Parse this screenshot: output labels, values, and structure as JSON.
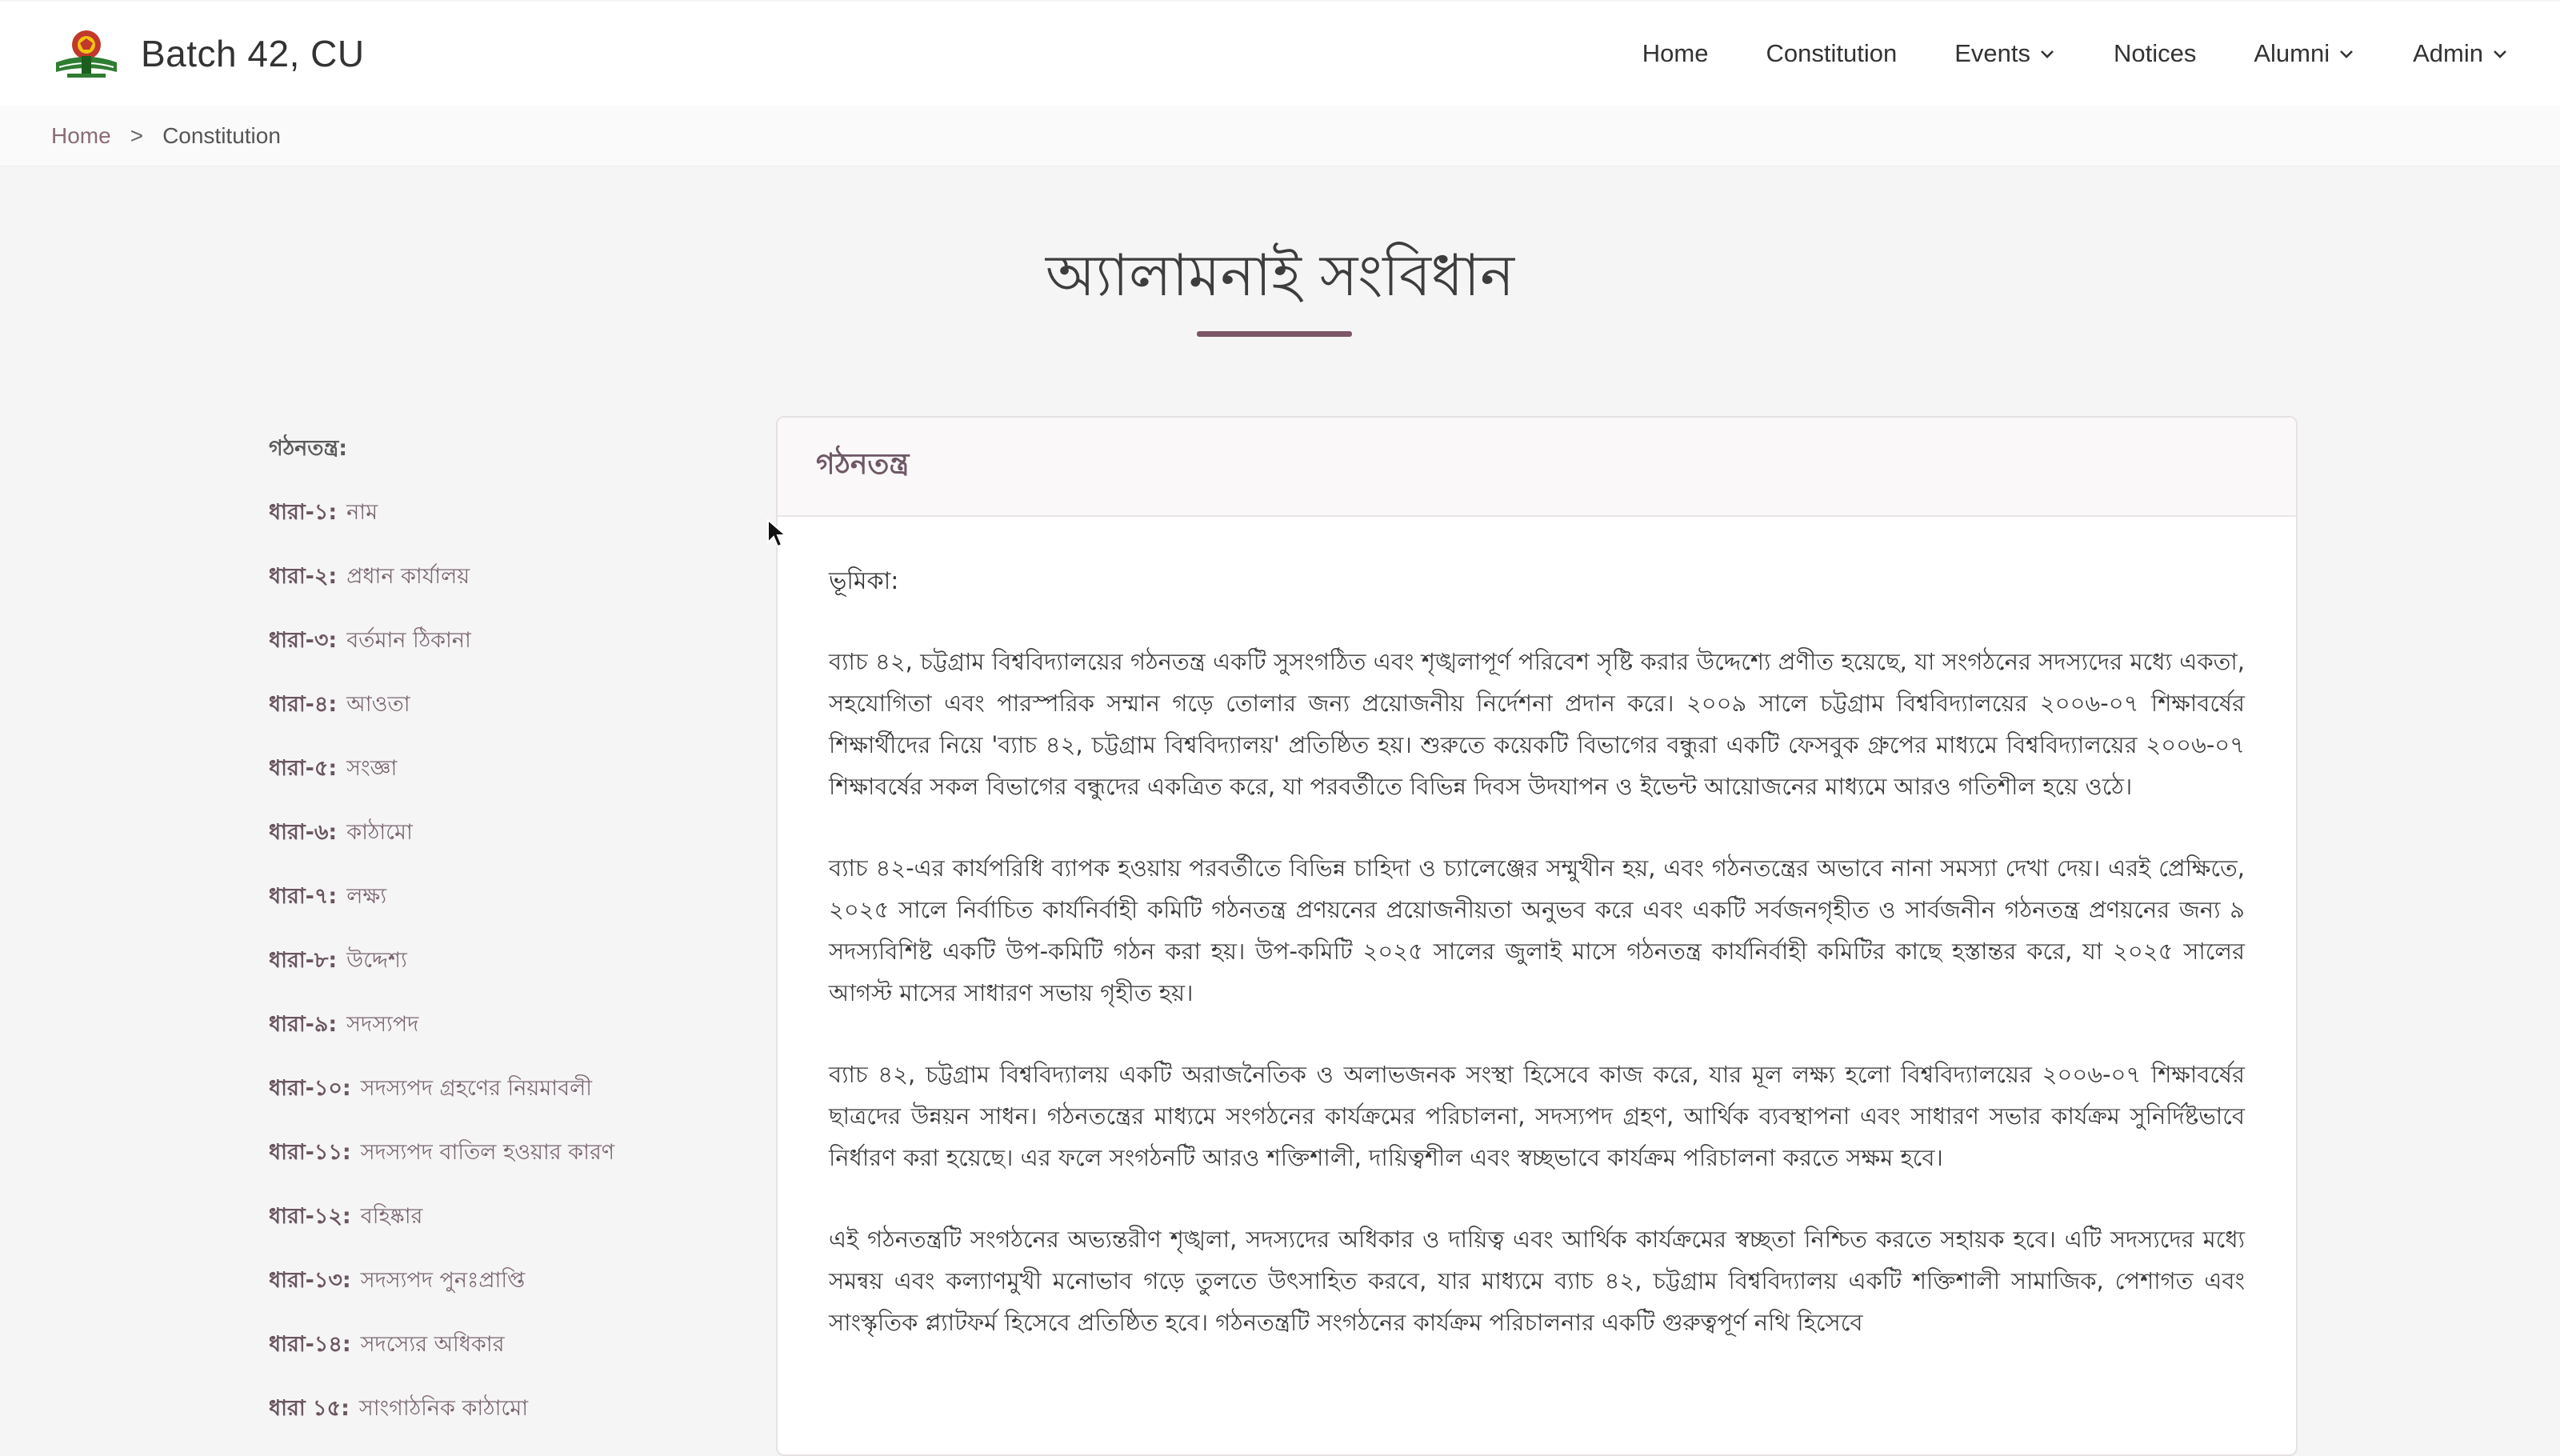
{
  "header": {
    "brand_title": "Batch 42, CU",
    "logo_icon": "batch-42-logo",
    "nav": [
      {
        "label": "Home",
        "has_dropdown": false
      },
      {
        "label": "Constitution",
        "has_dropdown": false
      },
      {
        "label": "Events",
        "has_dropdown": true
      },
      {
        "label": "Notices",
        "has_dropdown": false
      },
      {
        "label": "Alumni",
        "has_dropdown": true
      },
      {
        "label": "Admin",
        "has_dropdown": true
      }
    ]
  },
  "breadcrumb": {
    "home": "Home",
    "separator": ">",
    "current": "Constitution"
  },
  "page_title": "অ্যালামনাই সংবিধান",
  "toc": {
    "heading": "গঠনতন্ত্র:",
    "items": [
      {
        "num": "ধারা-১:",
        "label": "নাম"
      },
      {
        "num": "ধারা-২:",
        "label": "প্রধান কার্যালয়"
      },
      {
        "num": "ধারা-৩:",
        "label": "বর্তমান ঠিকানা"
      },
      {
        "num": "ধারা-৪:",
        "label": "আওতা"
      },
      {
        "num": "ধারা-৫:",
        "label": "সংজ্ঞা"
      },
      {
        "num": "ধারা-৬:",
        "label": "কাঠামো"
      },
      {
        "num": "ধারা-৭:",
        "label": "লক্ষ্য"
      },
      {
        "num": "ধারা-৮:",
        "label": "উদ্দেশ্য"
      },
      {
        "num": "ধারা-৯:",
        "label": "সদস্যপদ"
      },
      {
        "num": "ধারা-১০:",
        "label": "সদস্যপদ গ্রহণের নিয়মাবলী"
      },
      {
        "num": "ধারা-১১:",
        "label": "সদস্যপদ বাতিল হওয়ার কারণ"
      },
      {
        "num": "ধারা-১২:",
        "label": "বহিষ্কার"
      },
      {
        "num": "ধারা-১৩:",
        "label": "সদস্যপদ পুনঃপ্রাপ্তি"
      },
      {
        "num": "ধারা-১৪:",
        "label": "সদস্যের অধিকার"
      },
      {
        "num": "ধারা ১৫:",
        "label": "সাংগাঠনিক কাঠামো"
      }
    ]
  },
  "content": {
    "card_title": "গঠনতন্ত্র",
    "intro_heading": "ভূমিকা:",
    "paragraphs": [
      "ব্যাচ ৪২, চট্টগ্রাম বিশ্ববিদ্যালয়ের গঠনতন্ত্র একটি সুসংগঠিত এবং শৃঙ্খলাপূর্ণ পরিবেশ সৃষ্টি করার উদ্দেশ্যে প্রণীত হয়েছে, যা সংগঠনের সদস্যদের মধ্যে একতা, সহযোগিতা এবং পারস্পরিক সম্মান গড়ে তোলার জন্য প্রয়োজনীয় নির্দেশনা প্রদান করে। ২০০৯ সালে চট্টগ্রাম বিশ্ববিদ্যালয়ের ২০০৬-০৭ শিক্ষাবর্ষের শিক্ষার্থীদের নিয়ে 'ব্যাচ ৪২, চট্টগ্রাম বিশ্ববিদ্যালয়' প্রতিষ্ঠিত হয়। শুরুতে কয়েকটি বিভাগের বন্ধুরা একটি ফেসবুক গ্রুপের মাধ্যমে বিশ্ববিদ্যালয়ের ২০০৬-০৭ শিক্ষাবর্ষের সকল বিভাগের বন্ধুদের একত্রিত করে, যা পরবর্তীতে বিভিন্ন দিবস উদযাপন ও ইভেন্ট আয়োজনের মাধ্যমে আরও গতিশীল হয়ে ওঠে।",
      "ব্যাচ ৪২-এর কার্যপরিধি ব্যাপক হওয়ায় পরবর্তীতে বিভিন্ন চাহিদা ও চ্যালেঞ্জের সম্মুখীন হয়, এবং গঠনতন্ত্রের অভাবে নানা সমস্যা দেখা দেয়। এরই প্রেক্ষিতে, ২০২৫ সালে নির্বাচিত কার্যনির্বাহী কমিটি গঠনতন্ত্র প্রণয়নের প্রয়োজনীয়তা অনুভব করে এবং একটি সর্বজনগৃহীত ও সার্বজনীন গঠনতন্ত্র প্রণয়নের জন্য ৯ সদস্যবিশিষ্ট একটি উপ-কমিটি গঠন করা হয়। উপ-কমিটি ২০২৫ সালের জুলাই মাসে গঠনতন্ত্র কার্যনির্বাহী কমিটির কাছে হস্তান্তর করে, যা ২০২৫ সালের আগস্ট মাসের সাধারণ সভায় গৃহীত হয়।",
      "ব্যাচ ৪২, চট্টগ্রাম বিশ্ববিদ্যালয় একটি অরাজনৈতিক ও অলাভজনক সংস্থা হিসেবে কাজ করে, যার মূল লক্ষ্য হলো বিশ্ববিদ্যালয়ের ২০০৬-০৭ শিক্ষাবর্ষের ছাত্রদের উন্নয়ন সাধন। গঠনতন্ত্রের মাধ্যমে সংগঠনের কার্যক্রমের পরিচালনা, সদস্যপদ গ্রহণ, আর্থিক ব্যবস্থাপনা এবং সাধারণ সভার কার্যক্রম সুনির্দিষ্টভাবে নির্ধারণ করা হয়েছে। এর ফলে সংগঠনটি আরও শক্তিশালী, দায়িত্বশীল এবং স্বচ্ছভাবে কার্যক্রম পরিচালনা করতে সক্ষম হবে।",
      "এই গঠনতন্ত্রটি সংগঠনের অভ্যন্তরীণ শৃঙ্খলা, সদস্যদের অধিকার ও দায়িত্ব এবং আর্থিক কার্যক্রমের স্বচ্ছতা নিশ্চিত করতে সহায়ক হবে। এটি সদস্যদের মধ্যে সমন্বয় এবং কল্যাণমুখী মনোভাব গড়ে তুলতে উৎসাহিত করবে, যার মাধ্যমে ব্যাচ ৪২, চট্টগ্রাম বিশ্ববিদ্যালয় একটি শক্তিশালী সামাজিক, পেশাগত এবং সাংস্কৃতিক প্ল্যাটফর্ম হিসেবে প্রতিষ্ঠিত হবে। গঠনতন্ত্রটি সংগঠনের কার্যক্রম পরিচালনার একটি গুরুত্বপূর্ণ নথি হিসেবে"
    ]
  },
  "colors": {
    "accent": "#7a5666",
    "link": "#8a6b78",
    "toc_text": "#6a5560"
  }
}
